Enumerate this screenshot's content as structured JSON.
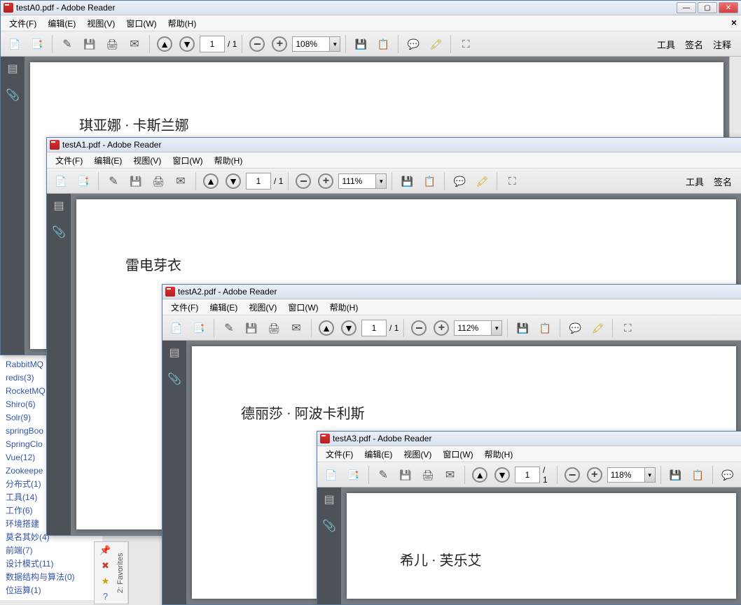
{
  "app_name": "Adobe Reader",
  "menu": {
    "file": "文件(F)",
    "edit": "编辑(E)",
    "view": "视图(V)",
    "window": "窗口(W)",
    "help": "帮助(H)"
  },
  "toolbar_right": {
    "tools": "工具",
    "sign": "签名",
    "comment": "注释"
  },
  "page_sep": "/",
  "windows": [
    {
      "file": "testA0.pdf",
      "page_current": "1",
      "page_total": "1",
      "zoom": "108%",
      "content": "琪亚娜 · 卡斯兰娜"
    },
    {
      "file": "testA1.pdf",
      "page_current": "1",
      "page_total": "1",
      "zoom": "111%",
      "content": "雷电芽衣"
    },
    {
      "file": "testA2.pdf",
      "page_current": "1",
      "page_total": "1",
      "zoom": "112%",
      "content": "德丽莎 · 阿波卡利斯"
    },
    {
      "file": "testA3.pdf",
      "page_current": "1",
      "page_total": "1",
      "zoom": "118%",
      "content": "希儿 · 芙乐艾"
    }
  ],
  "tags": [
    "RabbitMQ",
    "redis(3)",
    "RocketMQ",
    "Shiro(6)",
    "Solr(9)",
    "springBoo",
    "SpringClo",
    "Vue(12)",
    "Zookeepe",
    "分布式(1)",
    "工具(14)",
    "工作(6)",
    "环境搭建",
    "莫名其妙(4)",
    "前端(7)",
    "设计模式(11)",
    "数据结构与算法(0)",
    "位运算(1)"
  ],
  "favorites_label": "2: Favorites"
}
